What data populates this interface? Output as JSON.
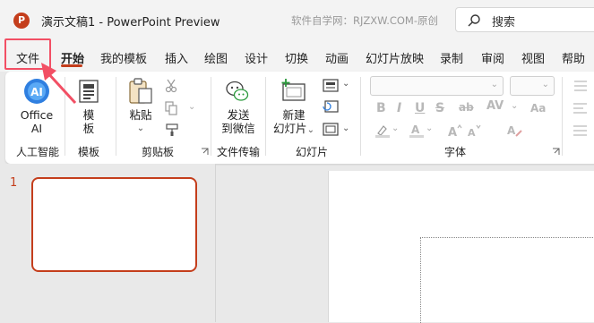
{
  "titlebar": {
    "app_icon_letter": "P",
    "document_title": "演示文稿1  -  PowerPoint Preview",
    "watermark": "软件自学网：RJZXW.COM-原创",
    "search_placeholder": "搜索"
  },
  "tabs": [
    "文件",
    "开始",
    "我的模板",
    "插入",
    "绘图",
    "设计",
    "切换",
    "动画",
    "幻灯片放映",
    "录制",
    "审阅",
    "视图",
    "帮助"
  ],
  "active_tab": "开始",
  "ribbon": {
    "office_ai_label_line1": "Office",
    "office_ai_label_line2": "AI",
    "office_ai_icon_text": "AI",
    "template_line1": "模",
    "template_line2": "板",
    "paste_label": "粘贴",
    "paste_chevron": "⌄",
    "send_line1": "发送",
    "send_line2": "到微信",
    "new_slide_line1": "新建",
    "new_slide_line2": "幻灯片",
    "new_slide_chevron": "⌄",
    "font_buttons": [
      "B",
      "I",
      "U",
      "S",
      "ab",
      "AV"
    ],
    "group_labels": {
      "ai": "人工智能",
      "template": "模板",
      "clipboard": "剪贴板",
      "file_transfer": "文件传输",
      "slides": "幻灯片",
      "font": "字体"
    }
  },
  "slide_panel": {
    "slide_numbers": [
      "1"
    ]
  },
  "colors": {
    "accent": "#c43e1c",
    "highlight_box": "#f24f64",
    "office_ai_blue": "#2f7fe0"
  }
}
